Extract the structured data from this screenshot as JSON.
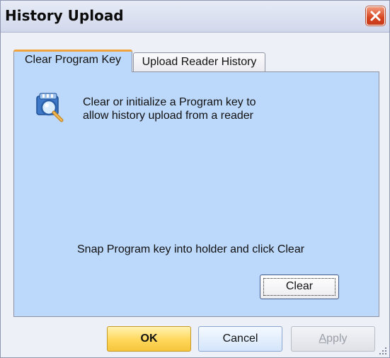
{
  "window": {
    "title": "History Upload"
  },
  "tabs": [
    {
      "label": "Clear Program Key",
      "active": true
    },
    {
      "label": "Upload Reader History",
      "active": false
    }
  ],
  "panel": {
    "description": "Clear or initialize a Program key to\nallow history upload from a reader",
    "instruction": "Snap Program key into holder and click Clear",
    "clear_label": "Clear",
    "icon": "program-key-search-icon"
  },
  "buttons": {
    "ok_label": "OK",
    "cancel_label": "Cancel",
    "apply_label_underlined": "A",
    "apply_label_rest": "pply",
    "apply_enabled": false
  },
  "colors": {
    "panel_bg": "#bcd8fb",
    "active_tab_accent": "#f0a33a",
    "ok_button": "#ffd75a",
    "close_button": "#d6451f"
  }
}
